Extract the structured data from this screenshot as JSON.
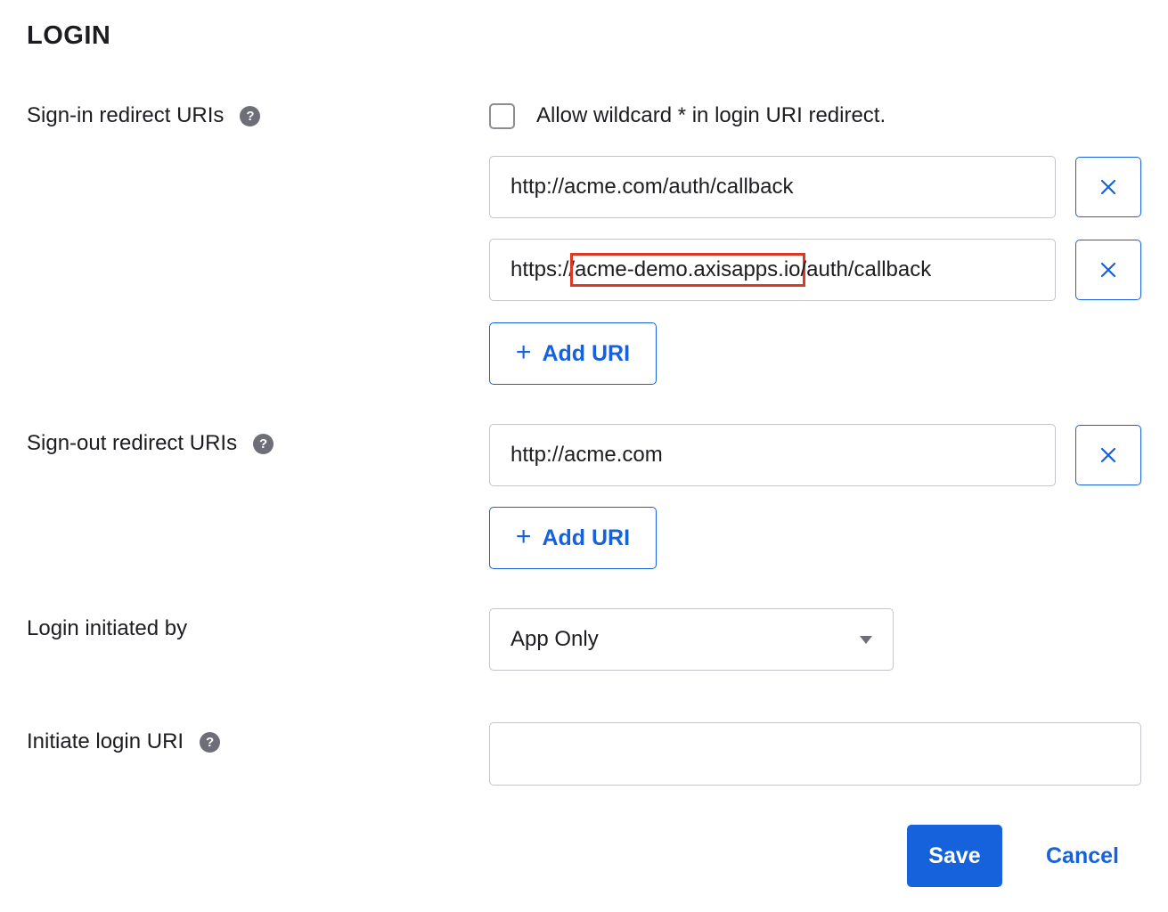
{
  "section": {
    "title": "LOGIN"
  },
  "signin": {
    "label": "Sign-in redirect URIs",
    "wildcard_label": "Allow wildcard * in login URI redirect.",
    "uris": [
      {
        "prefix": "http://acme.com/auth/callback",
        "highlight": "",
        "suffix": ""
      },
      {
        "prefix": "https://",
        "highlight": "acme-demo.axisapps.io",
        "suffix": "/auth/callback"
      }
    ],
    "add_label": "Add URI"
  },
  "signout": {
    "label": "Sign-out redirect URIs",
    "uris": [
      {
        "value": "http://acme.com"
      }
    ],
    "add_label": "Add URI"
  },
  "login_initiated": {
    "label": "Login initiated by",
    "selected": "App Only"
  },
  "initiate_uri": {
    "label": "Initiate login URI",
    "value": ""
  },
  "actions": {
    "save": "Save",
    "cancel": "Cancel"
  },
  "help_glyph": "?",
  "plus_glyph": "+",
  "icons": {
    "help": "help-circle-icon",
    "remove": "close-icon",
    "add": "plus-icon",
    "dropdown": "caret-down-icon"
  },
  "colors": {
    "primary": "#1662dd",
    "highlight_box": "#d93a26",
    "help_icon": "#6e6e78",
    "border": "#c4c4cc"
  }
}
